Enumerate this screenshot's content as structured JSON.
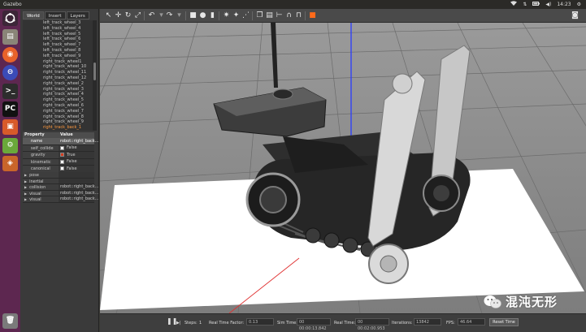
{
  "window": {
    "title": "Gazebo",
    "time": "14:23"
  },
  "tray": {
    "icons": [
      "wifi-icon",
      "sort-icon",
      "battery-icon",
      "volume-icon"
    ]
  },
  "launcher": {
    "items": [
      "ubuntu-logo-icon",
      "files-icon",
      "firefox-icon",
      "orb-icon",
      "terminal-icon",
      "pycharm-icon",
      "office-icon",
      "settings-icon",
      "package-icon",
      "trash-icon"
    ]
  },
  "left_panel": {
    "tabs": [
      {
        "label": "World"
      },
      {
        "label": "Insert"
      },
      {
        "label": "Layers"
      }
    ],
    "tree_items": [
      "left_track_wheel_3",
      "left_track_wheel_4",
      "left_track_wheel_5",
      "left_track_wheel_6",
      "left_track_wheel_7",
      "left_track_wheel_8",
      "left_track_wheel_9",
      "right_track_wheel1",
      "right_track_wheel_10",
      "right_track_wheel_11",
      "right_track_wheel_12",
      "right_track_wheel_2",
      "right_track_wheel_3",
      "right_track_wheel_4",
      "right_track_wheel_5",
      "right_track_wheel_6",
      "right_track_wheel_7",
      "right_track_wheel_8",
      "right_track_wheel_9",
      "right_track_back_1"
    ],
    "properties": {
      "header_property": "Property",
      "header_value": "Value",
      "rows": [
        {
          "key": "name",
          "value": "robot::right_back..."
        },
        {
          "key": "self_collide",
          "value": "False",
          "checked": false
        },
        {
          "key": "gravity",
          "value": "True",
          "checked": true
        },
        {
          "key": "kinematic",
          "value": "False",
          "checked": false
        },
        {
          "key": "canonical",
          "value": "False",
          "checked": false
        }
      ],
      "groups": [
        {
          "key": "pose",
          "value": ""
        },
        {
          "key": "inertial",
          "value": ""
        },
        {
          "key": "collision",
          "value": "robot::right_back..."
        },
        {
          "key": "visual",
          "value": "robot::right_back..."
        },
        {
          "key": "visual",
          "value": "robot::right_back..."
        }
      ]
    }
  },
  "toolbar": {
    "tools": [
      "select-arrow-icon",
      "translate-icon",
      "rotate-icon",
      "scale-icon",
      "undo-icon",
      "redo-icon",
      "box-icon",
      "sphere-icon",
      "cylinder-icon",
      "point-light-icon",
      "spot-light-icon",
      "directional-light-icon",
      "copy-icon",
      "paste-icon",
      "align-icon",
      "snap-icon",
      "orange-marker-icon",
      "screenshot-icon"
    ]
  },
  "bottom_bar": {
    "steps_label": "Steps:",
    "steps_value": "1",
    "rtf_label": "Real Time Factor:",
    "rtf_value": "0.13",
    "sim_time_label": "Sim Time:",
    "sim_time_value": "00 00:00:13.842",
    "real_time_label": "Real Time:",
    "real_time_value": "00 00:02:00.953",
    "iterations_label": "Iterations:",
    "iterations_value": "13842",
    "fps_label": "FPS:",
    "fps_value": "46.64",
    "reset_label": "Reset Time"
  },
  "watermark": {
    "text": "混沌无形"
  },
  "colors": {
    "launcher": "#5d2750",
    "accent_orange": "#ff9a40",
    "selected_row": "#5a5a5a",
    "axis_blue": "#2a3cff",
    "axis_red": "#e03030",
    "ground": "#ffffff"
  }
}
